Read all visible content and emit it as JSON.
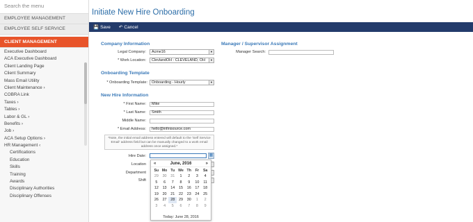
{
  "sidebar": {
    "search_placeholder": "Search the menu",
    "sections": [
      "EMPLOYEE MANAGEMENT",
      "EMPLOYEE SELF SERVICE",
      "CLIENT MANAGEMENT"
    ],
    "items": [
      {
        "label": "Executive Dashboard",
        "sub": false
      },
      {
        "label": "ACA Executive Dashboard",
        "sub": false
      },
      {
        "label": "Client Landing Page",
        "sub": false
      },
      {
        "label": "Client Summary",
        "sub": false
      },
      {
        "label": "Mass Email Utility",
        "sub": false
      },
      {
        "label": "Client Maintenance  ›",
        "sub": false
      },
      {
        "label": "COBRA Link",
        "sub": false
      },
      {
        "label": "Taxes  ›",
        "sub": false
      },
      {
        "label": "Tables  ›",
        "sub": false
      },
      {
        "label": "Labor & GL  ›",
        "sub": false
      },
      {
        "label": "Benefits  ›",
        "sub": false
      },
      {
        "label": "Job  ›",
        "sub": false
      },
      {
        "label": "ACA Setup Options  ›",
        "sub": false
      },
      {
        "label": "HR Management  ‹",
        "sub": false
      },
      {
        "label": "Certifications",
        "sub": true
      },
      {
        "label": "Education",
        "sub": true
      },
      {
        "label": "Skills",
        "sub": true
      },
      {
        "label": "Training",
        "sub": true
      },
      {
        "label": "Awards",
        "sub": true
      },
      {
        "label": "Disciplinary Authorities",
        "sub": true
      },
      {
        "label": "Disciplinary Offenses",
        "sub": true
      }
    ]
  },
  "page": {
    "title": "Initiate New Hire Onboarding",
    "toolbar": {
      "save": "Save",
      "cancel": "Cancel"
    }
  },
  "company": {
    "title": "Company Information",
    "legal_company_label": "Legal Company:",
    "legal_company_value": "Acme16",
    "work_location_label": "* Work Location:",
    "work_location_value": "ClevlandOH - CLEVELAND, OH"
  },
  "manager": {
    "title": "Manager / Supervisor Assignment",
    "search_label": "Manager Search:",
    "search_value": ""
  },
  "onboarding": {
    "title": "Onboarding Template",
    "template_label": "* Onboarding Template:",
    "template_value": "Onboarding - Hourly"
  },
  "newhire": {
    "title": "New Hire Information",
    "first_name_label": "* First Name:",
    "first_name_value": "Mike",
    "last_name_label": "* Last Name:",
    "last_name_value": "Smith",
    "middle_name_label": "Middle Name:",
    "middle_name_value": "",
    "email_label": "* Email Address:",
    "email_value": "hello@infinisource.com",
    "note": "*Note, the initial email address entered will default to the 'Self Service Email' address field but can be manually changed to a work email address once assigned.*",
    "hire_date_label": "Hire Date:",
    "hire_date_value": "",
    "location_label": "Location",
    "department_label": "Department",
    "shift_label": "Shift"
  },
  "calendar": {
    "prev": "«",
    "next": "»",
    "month": "June, 2016",
    "dow": [
      "Su",
      "Mo",
      "Tu",
      "We",
      "Th",
      "Fr",
      "Sa"
    ],
    "weeks": [
      [
        "29",
        "30",
        "31",
        "1",
        "2",
        "3",
        "4"
      ],
      [
        "5",
        "6",
        "7",
        "8",
        "9",
        "10",
        "11"
      ],
      [
        "12",
        "13",
        "14",
        "15",
        "16",
        "17",
        "18"
      ],
      [
        "19",
        "20",
        "21",
        "22",
        "23",
        "24",
        "25"
      ],
      [
        "26",
        "27",
        "28",
        "29",
        "30",
        "1",
        "2"
      ],
      [
        "3",
        "4",
        "5",
        "6",
        "7",
        "8",
        "9"
      ]
    ],
    "today_label": "Today: June 28, 2016"
  }
}
